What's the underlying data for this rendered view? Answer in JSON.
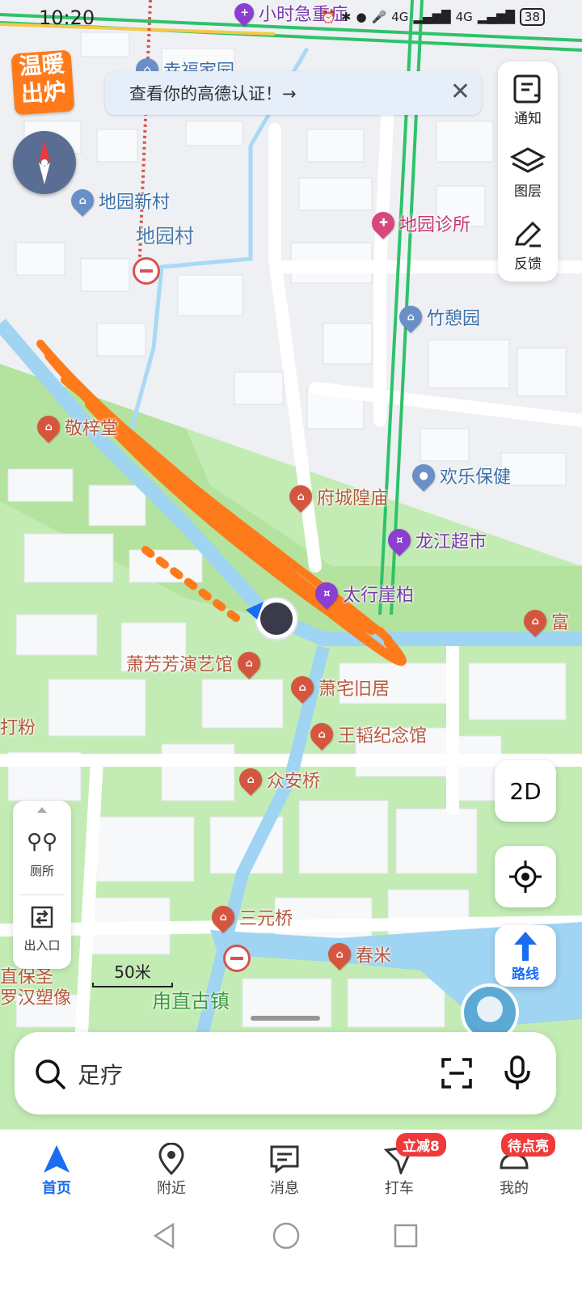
{
  "status_bar": {
    "time": "10:20",
    "network_labels": [
      "4G",
      "4G"
    ],
    "battery": "38"
  },
  "map": {
    "top_poi_partial": "小时急重症",
    "pois": [
      {
        "id": "xingfu",
        "name": "幸福家园",
        "style": "blue"
      },
      {
        "id": "diyuanxincun",
        "name": "地园新村",
        "style": "blue"
      },
      {
        "id": "diyuanzhensuo",
        "name": "地园诊所",
        "style": "pink"
      },
      {
        "id": "zhuqiyuan",
        "name": "竹憩园",
        "style": "blue"
      },
      {
        "id": "jingzi",
        "name": "敬梓堂",
        "style": "red"
      },
      {
        "id": "huanle",
        "name": "欢乐保健",
        "style": "blue"
      },
      {
        "id": "fucheng",
        "name": "府城隍庙",
        "style": "red"
      },
      {
        "id": "longjiang",
        "name": "龙江超市",
        "style": "purple"
      },
      {
        "id": "taihang",
        "name": "太行崖柏",
        "style": "purple"
      },
      {
        "id": "fu",
        "name": "富",
        "style": "red"
      },
      {
        "id": "xiaofangfang",
        "name": "萧芳芳演艺馆",
        "style": "red"
      },
      {
        "id": "xiaozhai",
        "name": "萧宅旧居",
        "style": "red"
      },
      {
        "id": "wangtao",
        "name": "王韬纪念馆",
        "style": "red"
      },
      {
        "id": "zhonganqiao",
        "name": "众安桥",
        "style": "red"
      },
      {
        "id": "sanyuanqiao",
        "name": "三元桥",
        "style": "red"
      },
      {
        "id": "chunmi",
        "name": "春米",
        "style": "red"
      }
    ],
    "area_labels": {
      "diyuancun": "地园村",
      "dafen": "打粉",
      "baosheng": "直保圣",
      "luohan": "罗汉塑像",
      "town": "甪直古镇"
    },
    "scale_label": "50米"
  },
  "banner": {
    "text": "查看你的高德认证！→"
  },
  "promo": {
    "line1": "温暖",
    "line2": "出炉"
  },
  "right_panel": {
    "notify": "通知",
    "layers": "图层",
    "feedback": "反馈"
  },
  "left_panel": {
    "toilet": "厕所",
    "entrance": "出入口"
  },
  "controls": {
    "mode_2d": "2D",
    "route": "路线"
  },
  "search": {
    "placeholder": "足疗"
  },
  "bottom_nav": {
    "tabs": [
      {
        "label": "首页"
      },
      {
        "label": "附近"
      },
      {
        "label": "消息"
      },
      {
        "label": "打车",
        "badge": "立减8"
      },
      {
        "label": "我的",
        "badge": "待点亮"
      }
    ]
  },
  "colors": {
    "accent": "#1a6cf0",
    "water": "#9fd4f2",
    "park": "#b9e6a6",
    "scribble": "#ff7a1a",
    "badge": "#f0393a"
  }
}
